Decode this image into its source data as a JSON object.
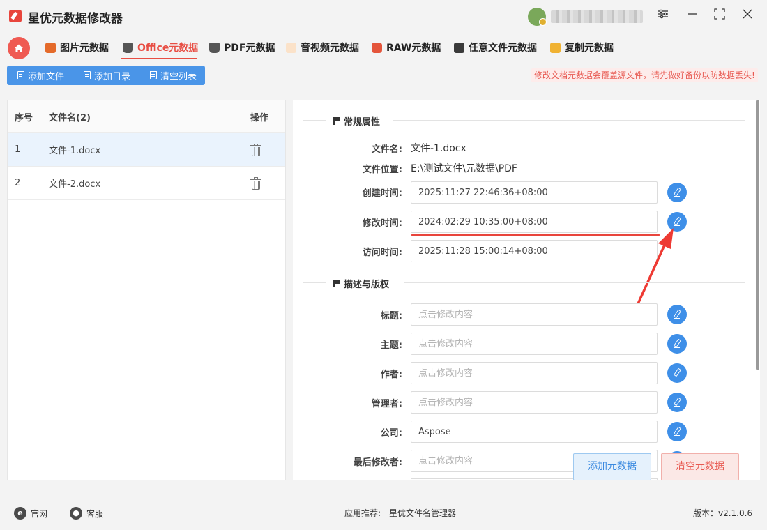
{
  "app": {
    "title": "星优元数据修改器"
  },
  "window_controls": {
    "settings": "⚙",
    "minimize": "—",
    "maximize": "⛶",
    "close": "✕"
  },
  "nav": {
    "tabs": [
      {
        "label": "图片元数据",
        "icon": "image-icon"
      },
      {
        "label": "Office元数据",
        "icon": "office-icon",
        "active": true
      },
      {
        "label": "PDF元数据",
        "icon": "pdf-icon"
      },
      {
        "label": "音视频元数据",
        "icon": "media-icon"
      },
      {
        "label": "RAW元数据",
        "icon": "raw-icon"
      },
      {
        "label": "任意文件元数据",
        "icon": "file-icon"
      },
      {
        "label": "复制元数据",
        "icon": "copy-icon"
      }
    ]
  },
  "toolbar": {
    "add_file": "添加文件",
    "add_folder": "添加目录",
    "clear_list": "清空列表",
    "warning": "修改文档元数据会覆盖源文件，请先做好备份以防数据丢失!"
  },
  "file_table": {
    "headers": {
      "num": "序号",
      "name": "文件名(2)",
      "op": "操作"
    },
    "rows": [
      {
        "num": "1",
        "name": "文件-1.docx",
        "selected": true
      },
      {
        "num": "2",
        "name": "文件-2.docx",
        "selected": false
      }
    ]
  },
  "general": {
    "section_title": "常规属性",
    "file_name_label": "文件名:",
    "file_name_value": "文件-1.docx",
    "location_label": "文件位置:",
    "location_value": "E:\\测试文件\\元数据\\PDF",
    "created_label": "创建时间:",
    "created_value": "2025:11:27 22:46:36+08:00",
    "modified_label": "修改时间:",
    "modified_value": "2024:02:29 10:35:00+08:00",
    "accessed_label": "访问时间:",
    "accessed_value": "2025:11:28 15:00:14+08:00"
  },
  "description": {
    "section_title": "描述与版权",
    "placeholder": "点击修改内容",
    "title_label": "标题:",
    "subject_label": "主题:",
    "author_label": "作者:",
    "manager_label": "管理者:",
    "company_label": "公司:",
    "company_value": "Aspose",
    "last_modified_by_label": "最后修改者:"
  },
  "actions": {
    "add_meta": "添加元数据",
    "clear_meta": "清空元数据"
  },
  "footer": {
    "website": "官网",
    "support": "客服",
    "recommend_label": "应用推荐:",
    "recommend_app": "星优文件名管理器",
    "version": "版本：v2.1.0.6"
  },
  "colors": {
    "accent": "#e84e44",
    "primary": "#4a95e8",
    "edit": "#3e8fe8"
  }
}
